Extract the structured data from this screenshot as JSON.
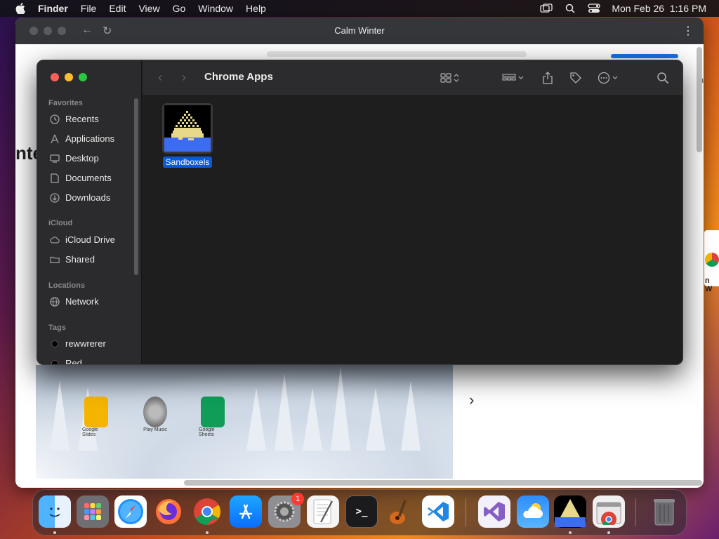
{
  "menubar": {
    "app_name": "Finder",
    "menus": [
      "File",
      "Edit",
      "View",
      "Go",
      "Window",
      "Help"
    ],
    "datetime": "Mon Feb 26  1:16 PM",
    "icons": [
      "apple-logo-icon",
      "screen-mirroring-icon",
      "spotlight-search-icon",
      "control-center-icon"
    ]
  },
  "chrome": {
    "window_title": "Calm Winter",
    "bg_left_text": "nte",
    "bg_right_text": "n",
    "peek_text": "n W",
    "photo_apps": [
      "Google Slides",
      "Play Music",
      "Google Sheets"
    ]
  },
  "finder": {
    "title": "Chrome Apps",
    "sidebar": {
      "favorites_label": "Favorites",
      "favorites": [
        {
          "label": "Recents",
          "icon": "clock-icon"
        },
        {
          "label": "Applications",
          "icon": "applications-icon"
        },
        {
          "label": "Desktop",
          "icon": "desktop-icon"
        },
        {
          "label": "Documents",
          "icon": "document-icon"
        },
        {
          "label": "Downloads",
          "icon": "download-icon"
        }
      ],
      "icloud_label": "iCloud",
      "icloud": [
        {
          "label": "iCloud Drive",
          "icon": "cloud-icon"
        },
        {
          "label": "Shared",
          "icon": "shared-folder-icon"
        }
      ],
      "locations_label": "Locations",
      "locations": [
        {
          "label": "Network",
          "icon": "globe-icon"
        }
      ],
      "tags_label": "Tags",
      "tags": [
        {
          "label": "rewwrerer",
          "color": "#000000"
        },
        {
          "label": "Red",
          "color": "#000000"
        }
      ]
    },
    "files": [
      {
        "name": "Sandboxels",
        "selected": true
      }
    ]
  },
  "dock": {
    "apps": [
      {
        "name": "Finder",
        "icon": "finder-icon",
        "running": true
      },
      {
        "name": "Launchpad",
        "icon": "launchpad-icon",
        "running": false
      },
      {
        "name": "Safari",
        "icon": "safari-icon",
        "running": false
      },
      {
        "name": "Firefox",
        "icon": "firefox-icon",
        "running": false
      },
      {
        "name": "Google Chrome",
        "icon": "chrome-icon",
        "running": true
      },
      {
        "name": "App Store",
        "icon": "app-store-icon",
        "running": false
      },
      {
        "name": "System Settings",
        "icon": "settings-icon",
        "running": false,
        "badge": "1"
      },
      {
        "name": "TextEdit",
        "icon": "textedit-icon",
        "running": false
      },
      {
        "name": "Terminal",
        "icon": "terminal-icon",
        "running": false
      },
      {
        "name": "GarageBand",
        "icon": "garageband-icon",
        "running": false
      },
      {
        "name": "Visual Studio Code",
        "icon": "vscode-icon",
        "running": false
      },
      {
        "name": "Visual Studio",
        "icon": "visual-studio-icon",
        "running": false
      },
      {
        "name": "Weather",
        "icon": "weather-icon",
        "running": false
      },
      {
        "name": "Sandboxels",
        "icon": "sandboxels-icon",
        "running": true
      },
      {
        "name": "Chrome Apps",
        "icon": "chrome-apps-icon",
        "running": true
      },
      {
        "name": "Trash",
        "icon": "trash-icon",
        "running": false
      }
    ]
  }
}
